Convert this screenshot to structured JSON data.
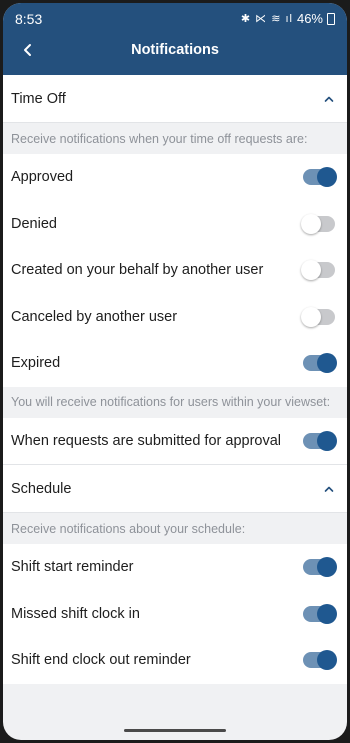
{
  "status_bar": {
    "time": "8:53",
    "icons": "✱ ⋉ ≋ ıl",
    "battery": "46%"
  },
  "header": {
    "title": "Notifications",
    "back_icon": "chevron-left-icon"
  },
  "colors": {
    "header_bg": "#24507d",
    "toggle_on": "#1f5890",
    "toggle_on_track": "#6d91b5",
    "toggle_off_track": "#c8c9cc"
  },
  "time_off": {
    "title": "Time Off",
    "info": "Receive notifications when your time off requests are:",
    "items": [
      {
        "label": "Approved",
        "enabled": true
      },
      {
        "label": "Denied",
        "enabled": false
      },
      {
        "label": "Created on your behalf by another user",
        "enabled": false
      },
      {
        "label": "Canceled by another user",
        "enabled": false
      },
      {
        "label": "Expired",
        "enabled": true
      }
    ],
    "viewset_info": "You will receive notifications for users within your viewset:",
    "viewset_items": [
      {
        "label": "When requests are submitted for approval",
        "enabled": true
      }
    ]
  },
  "schedule": {
    "title": "Schedule",
    "info": "Receive notifications about your schedule:",
    "items": [
      {
        "label": "Shift start reminder",
        "enabled": true
      },
      {
        "label": "Missed shift clock in",
        "enabled": true
      },
      {
        "label": "Shift end clock out reminder",
        "enabled": true
      }
    ]
  }
}
